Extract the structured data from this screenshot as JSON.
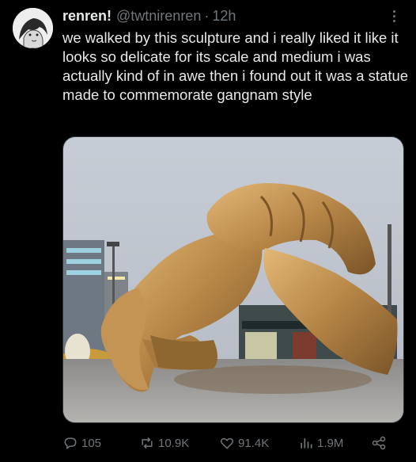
{
  "tweet": {
    "display_name": "renren!",
    "handle": "@twtnirenren",
    "separator": "·",
    "time": "12h",
    "text": "we walked by this sculpture and i really liked it like it looks so delicate for its scale and medium i was actually kind of in awe then i found out it was a statue made to commemorate gangnam style"
  },
  "actions": {
    "replies": "105",
    "retweets": "10.9K",
    "likes": "91.4K",
    "views": "1.9M"
  },
  "icons": {
    "avatar": "user-avatar",
    "more": "more-dots-icon",
    "reply": "reply-bubble-icon",
    "retweet": "retweet-icon",
    "like": "heart-icon",
    "views": "views-bars-icon",
    "share": "share-icon"
  },
  "colors": {
    "background": "#000000",
    "text": "#e7e9ea",
    "muted": "#71767b",
    "sculpture_gold": "#b98a4c"
  }
}
